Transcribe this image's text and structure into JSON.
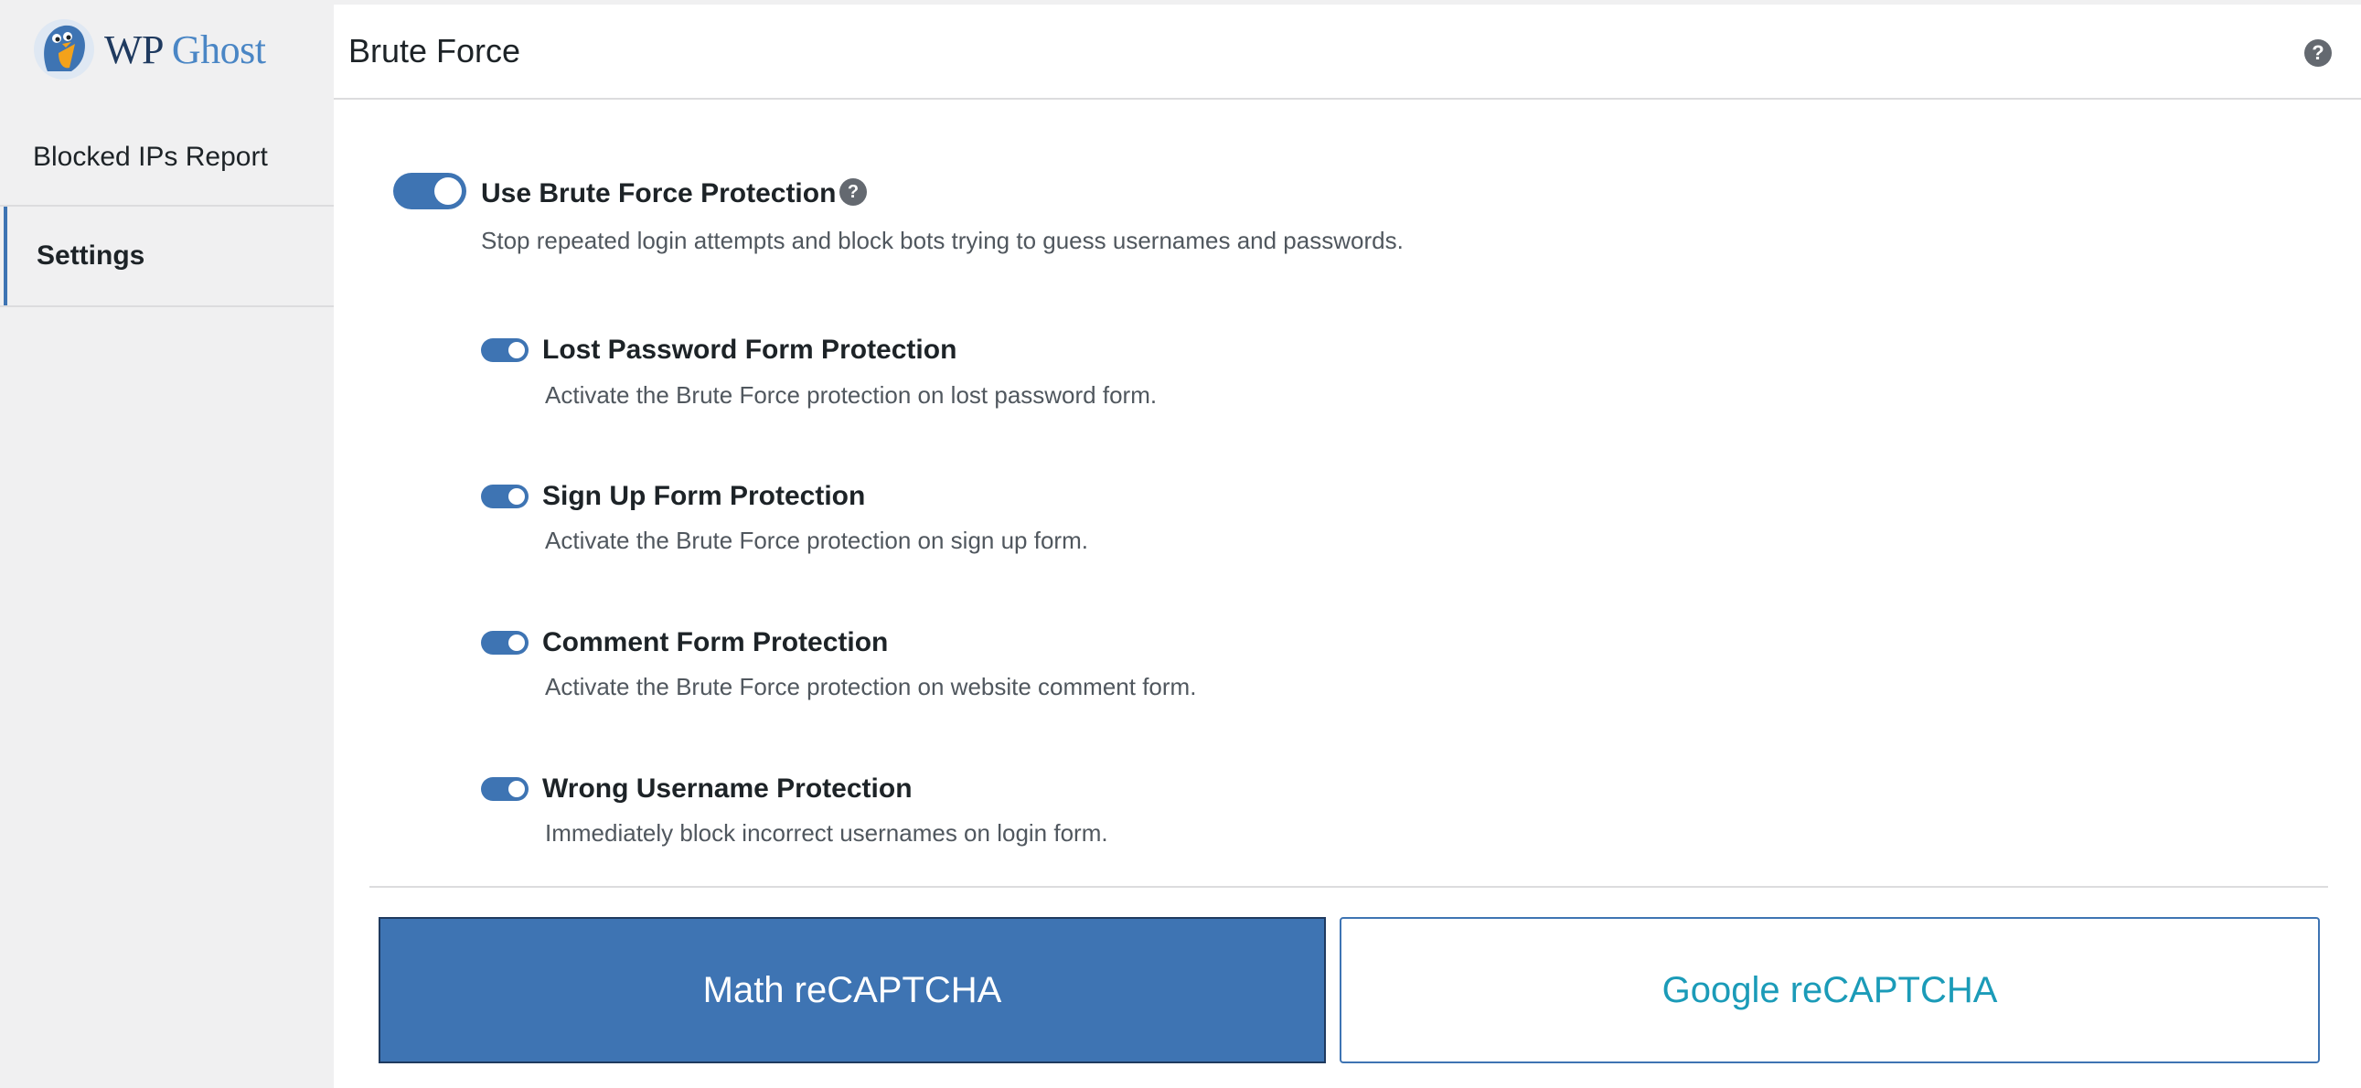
{
  "brand": {
    "wp": "WP",
    "ghost": "Ghost"
  },
  "sidebar": {
    "items": [
      {
        "label": "Blocked IPs Report"
      },
      {
        "label": "Settings",
        "active": true
      }
    ]
  },
  "header": {
    "title": "Brute Force",
    "help_icon": "help-icon"
  },
  "main_option": {
    "label": "Use Brute Force Protection",
    "description": "Stop repeated login attempts and block bots trying to guess usernames and passwords.",
    "enabled": true
  },
  "options": [
    {
      "label": "Lost Password Form Protection",
      "description": "Activate the Brute Force protection on lost password form.",
      "enabled": true
    },
    {
      "label": "Sign Up Form Protection",
      "description": "Activate the Brute Force protection on sign up form.",
      "enabled": true
    },
    {
      "label": "Comment Form Protection",
      "description": "Activate the Brute Force protection on website comment form.",
      "enabled": true
    },
    {
      "label": "Wrong Username Protection",
      "description": "Immediately block incorrect usernames on login form.",
      "enabled": true
    }
  ],
  "captcha_tabs": [
    {
      "label": "Math reCAPTCHA",
      "selected": true
    },
    {
      "label": "Google reCAPTCHA",
      "selected": false
    }
  ],
  "colors": {
    "accent": "#3e74b3",
    "google_text": "#1b9bb8",
    "sidebar_bg": "#f0f0f1"
  }
}
